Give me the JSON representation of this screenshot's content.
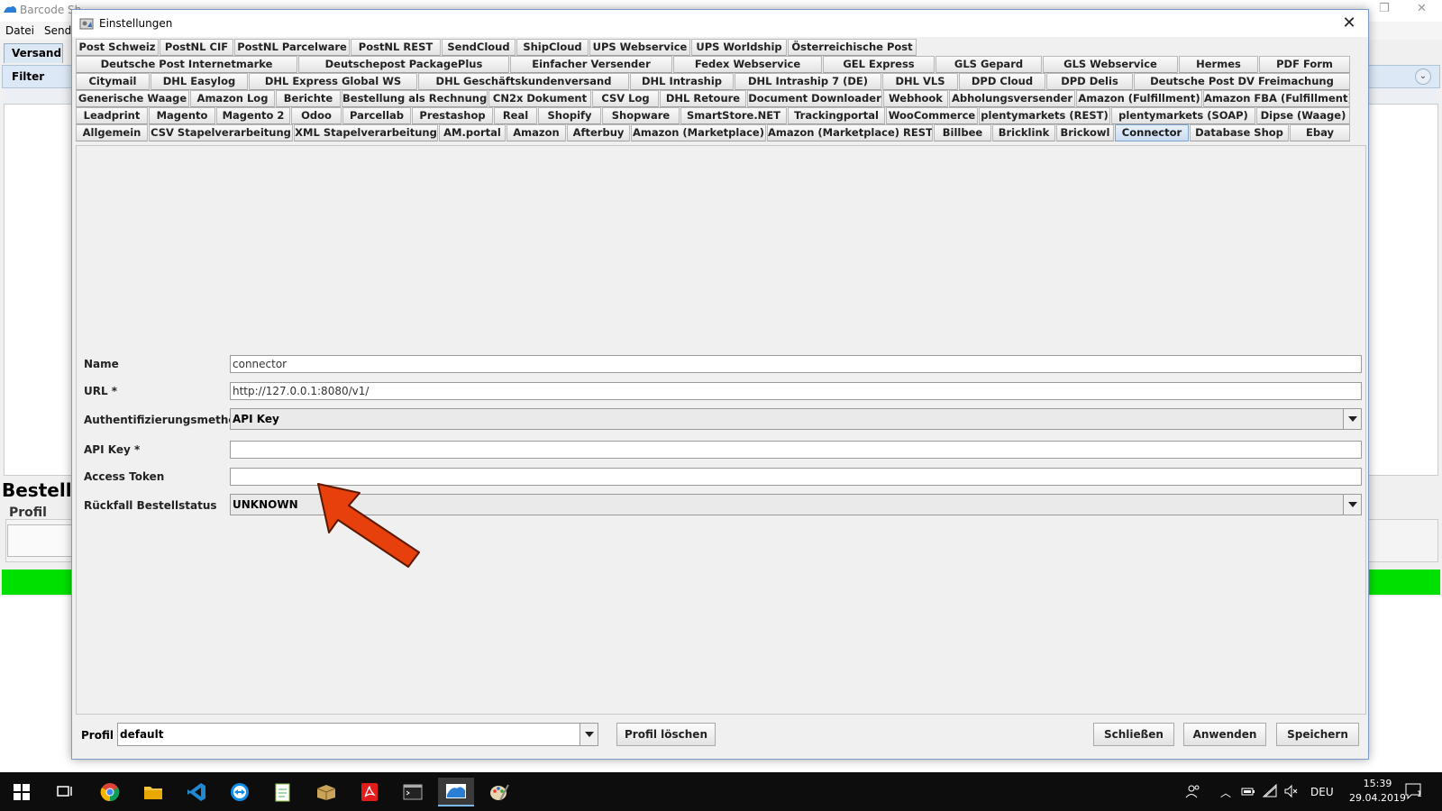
{
  "background_app": {
    "title": "Barcode Sh",
    "menu": [
      "Datei",
      "Send"
    ],
    "tab": "Versand",
    "filter_label": "Filter",
    "section_title": "Bestellu",
    "profil_label": "Profil"
  },
  "dialog": {
    "title": "Einstellungen",
    "tab_rows": [
      [
        "Post Schweiz",
        "PostNL CIF",
        "PostNL Parcelware",
        "PostNL REST",
        "SendCloud",
        "ShipCloud",
        "UPS Webservice",
        "UPS Worldship",
        "Österreichische Post"
      ],
      [
        "Deutsche Post Internetmarke",
        "Deutschepost PackagePlus",
        "Einfacher Versender",
        "Fedex Webservice",
        "GEL Express",
        "GLS Gepard",
        "GLS Webservice",
        "Hermes",
        "PDF Form"
      ],
      [
        "Citymail",
        "DHL Easylog",
        "DHL Express Global WS",
        "DHL Geschäftskundenversand",
        "DHL Intraship",
        "DHL Intraship 7 (DE)",
        "DHL VLS",
        "DPD Cloud",
        "DPD Delis",
        "Deutsche Post DV Freimachung"
      ],
      [
        "Generische Waage",
        "Amazon Log",
        "Berichte",
        "Bestellung als Rechnung",
        "CN2x Dokument",
        "CSV Log",
        "DHL Retoure",
        "Document Downloader",
        "Webhook",
        "Abholungsversender",
        "Amazon (Fulfillment)",
        "Amazon FBA (Fulfillment)"
      ],
      [
        "Leadprint",
        "Magento",
        "Magento 2",
        "Odoo",
        "Parcellab",
        "Prestashop",
        "Real",
        "Shopify",
        "Shopware",
        "SmartStore.NET",
        "Trackingportal",
        "WooCommerce",
        "plentymarkets (REST)",
        "plentymarkets (SOAP)",
        "Dipse (Waage)"
      ],
      [
        "Allgemein",
        "CSV Stapelverarbeitung",
        "XML Stapelverarbeitung",
        "AM.portal",
        "Amazon",
        "Afterbuy",
        "Amazon (Marketplace)",
        "Amazon (Marketplace) REST",
        "Billbee",
        "Bricklink",
        "Brickowl",
        "Connector",
        "Database Shop",
        "Ebay"
      ]
    ],
    "active_tab": "Connector",
    "form": {
      "name_label": "Name",
      "name_value": "connector",
      "url_label": "URL *",
      "url_value": "http://127.0.0.1:8080/v1/",
      "auth_label": "Authentifizierungsmethode",
      "auth_value": "API Key",
      "apikey_label": "API Key *",
      "apikey_value": "",
      "token_label": "Access Token",
      "token_value": "",
      "fallback_label": "Rückfall Bestellstatus",
      "fallback_value": "UNKNOWN"
    },
    "bottom": {
      "profil_label": "Profil",
      "profil_value": "default",
      "delete_profile": "Profil löschen",
      "close": "Schließen",
      "apply": "Anwenden",
      "save": "Speichern"
    }
  },
  "taskbar": {
    "language": "DEU",
    "time": "15:39",
    "date": "29.04.2019",
    "notification_count": "1"
  },
  "colors": {
    "arrow": "#e8400c",
    "green_bar": "#00e000",
    "active_tab": "#c9dcf0"
  }
}
